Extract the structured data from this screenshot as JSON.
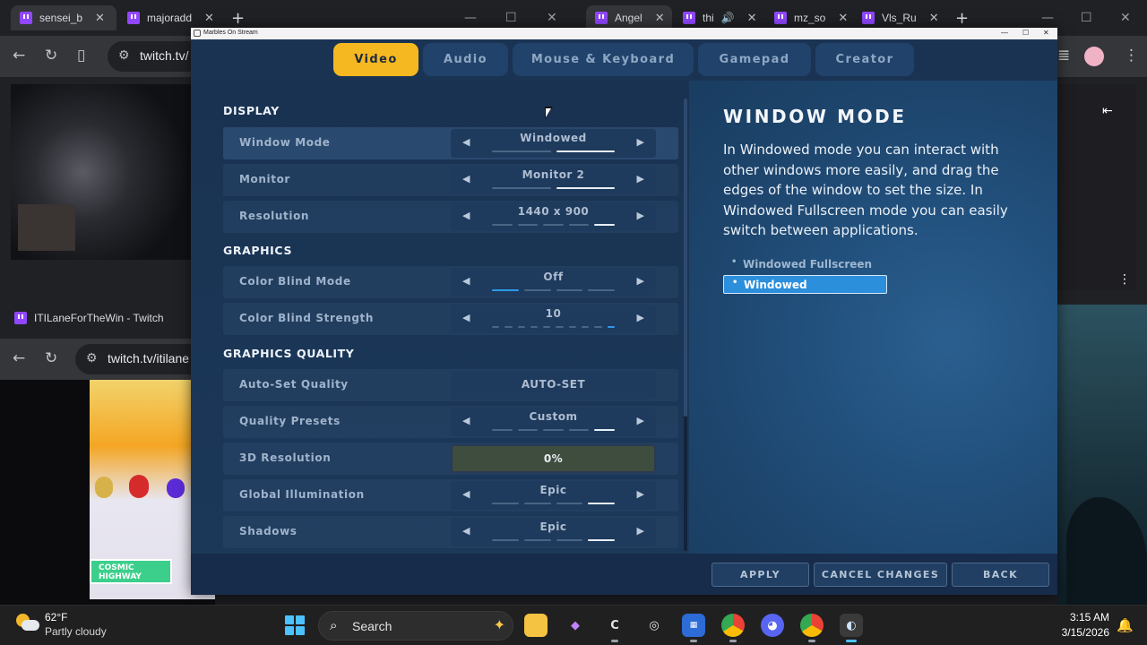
{
  "browser_left": {
    "tabs": [
      {
        "title": "sensei_b",
        "close": "✕"
      },
      {
        "title": "majoradd",
        "close": "✕"
      }
    ],
    "new_tab": "+",
    "address": "twitch.tv/"
  },
  "browser_right": {
    "tabs": [
      {
        "title": "Angel",
        "close": "✕"
      },
      {
        "title": "thi",
        "close": "✕"
      },
      {
        "title": "mz_so",
        "close": "✕"
      },
      {
        "title": "Vls_Ru",
        "close": "✕"
      }
    ],
    "new_tab": "+"
  },
  "browser_lower": {
    "title": "ITILaneForTheWin - Twitch",
    "address": "twitch.tv/itilane",
    "stream_badge": "COSMIC HIGHWAY"
  },
  "game_window": {
    "title": "Marbles On Stream",
    "tabs": [
      {
        "label": "Video",
        "active": true
      },
      {
        "label": "Audio",
        "active": false
      },
      {
        "label": "Mouse & Keyboard",
        "active": false
      },
      {
        "label": "Gamepad",
        "active": false
      },
      {
        "label": "Creator",
        "active": false
      }
    ],
    "sections": {
      "display": "DISPLAY",
      "graphics": "GRAPHICS",
      "quality": "GRAPHICS QUALITY"
    },
    "settings": [
      {
        "label": "Window Mode",
        "value": "Windowed",
        "steps": 2,
        "level": 2
      },
      {
        "label": "Monitor",
        "value": "Monitor 2",
        "steps": 2,
        "level": 2
      },
      {
        "label": "Resolution",
        "value": "1440 x 900",
        "steps": 5,
        "level": 5
      },
      {
        "label": "Color Blind Mode",
        "value": "Off",
        "steps": 4,
        "level": 1
      },
      {
        "label": "Color Blind Strength",
        "value": "10",
        "steps": 10,
        "level": 10
      },
      {
        "label": "Auto-Set Quality",
        "value": "AUTO-SET"
      },
      {
        "label": "Quality Presets",
        "value": "Custom",
        "steps": 5,
        "level": 5
      },
      {
        "label": "3D Resolution",
        "value": "0%"
      },
      {
        "label": "Global Illumination",
        "value": "Epic",
        "steps": 4,
        "level": 4
      },
      {
        "label": "Shadows",
        "value": "Epic",
        "steps": 4,
        "level": 4
      }
    ],
    "arrow_left": "◀",
    "arrow_right": "▶",
    "info": {
      "title": "WINDOW MODE",
      "description": "In Windowed mode you can interact with other windows more easily, and drag the edges of the window to set the size. In Windowed Fullscreen mode you can easily switch between applications.",
      "options": [
        "Windowed Fullscreen",
        "Windowed"
      ],
      "selected": "Windowed"
    },
    "buttons": {
      "apply": "APPLY",
      "cancel": "CANCEL CHANGES",
      "back": "BACK"
    }
  },
  "taskbar": {
    "temperature": "62°F",
    "weather": "Partly cloudy",
    "search": "Search",
    "time": "3:15 AM",
    "date": "3/15/2026"
  },
  "colors": {
    "accent": "#f6b820",
    "selected_option": "#2c8fdc",
    "panel": "#1a3252"
  }
}
